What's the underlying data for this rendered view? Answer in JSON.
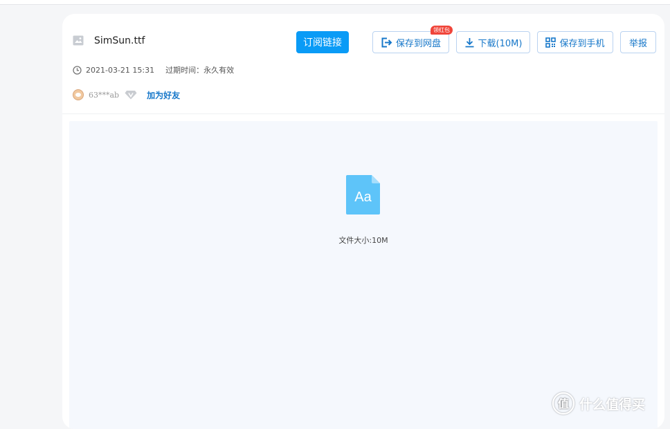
{
  "file": {
    "name": "SimSun.ttf",
    "icon": "image-file-icon"
  },
  "actions": {
    "subscribe_label": "订阅链接",
    "save_cloud_label": "保存到网盘",
    "save_cloud_badge": "领红包",
    "download_label": "下载(10M)",
    "save_phone_label": "保存到手机",
    "report_label": "举报"
  },
  "meta": {
    "date": "2021-03-21 15:31",
    "expiry": "过期时间：永久有效"
  },
  "user": {
    "name": "63***ab",
    "add_friend_label": "加为好友"
  },
  "preview": {
    "icon_text": "Aa",
    "size_text": "文件大小:10M"
  },
  "watermark": {
    "text": "什么值得买"
  },
  "colors": {
    "accent": "#0a9bf6",
    "link": "#1677c9",
    "badge": "#f0453a",
    "file_icon": "#5ec4f9"
  }
}
